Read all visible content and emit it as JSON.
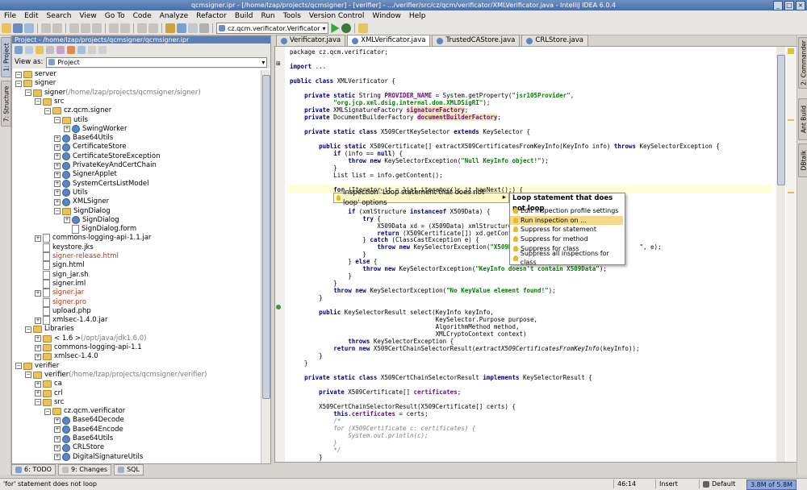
{
  "window": {
    "title": "qcmsigner.ipr - [/home/lzap/projects/qcmsigner] - [verifier] - .../verifier/src/cz/qcm/verificator/XMLVerificator.java - IntelliJ IDEA 6.0.4"
  },
  "menu": [
    "File",
    "Edit",
    "Search",
    "View",
    "Go To",
    "Code",
    "Analyze",
    "Refactor",
    "Build",
    "Run",
    "Tools",
    "Version Control",
    "Window",
    "Help"
  ],
  "toolbar": {
    "run_config": "cz.qcm.verificator.Verificator"
  },
  "left_stripe": {
    "project_tab": "1: Project",
    "structure_tab": "7: Structure"
  },
  "right_stripe": {
    "commander_tab": "2: Commander",
    "ant_tab": "Ant Build",
    "db_tab": "DBtalk"
  },
  "project": {
    "header": "Project - /home/lzap/projects/qcmsigner/qcmsigner.ipr",
    "view_as_label": "View as:",
    "view_as_value": "Project",
    "tree": [
      {
        "d": 0,
        "t": "-",
        "icon": "fold",
        "label": "server"
      },
      {
        "d": 0,
        "t": "-",
        "icon": "fold",
        "label": "signer"
      },
      {
        "d": 1,
        "t": "-",
        "icon": "fold",
        "label": "signer",
        "extra": " (/home/lzap/projects/qcmsigner/signer)"
      },
      {
        "d": 2,
        "t": "-",
        "icon": "fold",
        "label": "src"
      },
      {
        "d": 3,
        "t": "-",
        "icon": "fold",
        "label": "cz.qcm.signer"
      },
      {
        "d": 4,
        "t": "-",
        "icon": "fold",
        "label": "utils"
      },
      {
        "d": 5,
        "t": "+",
        "icon": "cls",
        "label": "SwingWorker"
      },
      {
        "d": 4,
        "t": "+",
        "icon": "cls",
        "label": "Base64Utils"
      },
      {
        "d": 4,
        "t": "+",
        "icon": "cls",
        "label": "CertificateStore"
      },
      {
        "d": 4,
        "t": "+",
        "icon": "cls",
        "label": "CertificateStoreException"
      },
      {
        "d": 4,
        "t": "+",
        "icon": "cls",
        "label": "PrivateKeyAndCertChain"
      },
      {
        "d": 4,
        "t": "+",
        "icon": "cls",
        "label": "SignerApplet"
      },
      {
        "d": 4,
        "t": "+",
        "icon": "cls",
        "label": "SystemCertsListModel"
      },
      {
        "d": 4,
        "t": "+",
        "icon": "cls",
        "label": "Utils"
      },
      {
        "d": 4,
        "t": "+",
        "icon": "cls",
        "label": "XMLSigner"
      },
      {
        "d": 4,
        "t": "-",
        "icon": "fold",
        "label": "SignDialog"
      },
      {
        "d": 5,
        "t": "+",
        "icon": "cls",
        "label": "SignDialog"
      },
      {
        "d": 5,
        "t": "",
        "icon": "file",
        "label": "SignDialog.form"
      },
      {
        "d": 2,
        "t": "+",
        "icon": "file",
        "label": "commons-logging-api-1.1.jar"
      },
      {
        "d": 2,
        "t": "",
        "icon": "file",
        "label": "keystore.jks"
      },
      {
        "d": 2,
        "t": "",
        "icon": "file",
        "label": "signer-release.html",
        "cls": "red"
      },
      {
        "d": 2,
        "t": "",
        "icon": "file",
        "label": "sign.html"
      },
      {
        "d": 2,
        "t": "",
        "icon": "file",
        "label": "sign_jar.sh"
      },
      {
        "d": 2,
        "t": "",
        "icon": "file",
        "label": "signer.iml"
      },
      {
        "d": 2,
        "t": "+",
        "icon": "file",
        "label": "signer.jar",
        "cls": "red"
      },
      {
        "d": 2,
        "t": "",
        "icon": "file",
        "label": "signer.pro",
        "cls": "red"
      },
      {
        "d": 2,
        "t": "",
        "icon": "file",
        "label": "upload.php"
      },
      {
        "d": 2,
        "t": "+",
        "icon": "file",
        "label": "xmlsec-1.4.0.jar"
      },
      {
        "d": 1,
        "t": "-",
        "icon": "fold",
        "label": "Libraries"
      },
      {
        "d": 2,
        "t": "+",
        "icon": "fold",
        "label": "< 1.6 >",
        "extra": " (/opt/java/jdk1.6.0)"
      },
      {
        "d": 2,
        "t": "+",
        "icon": "fold",
        "label": "commons-logging-api-1.1"
      },
      {
        "d": 2,
        "t": "+",
        "icon": "fold",
        "label": "xmlsec-1.4.0"
      },
      {
        "d": 0,
        "t": "-",
        "icon": "fold",
        "label": "verifier"
      },
      {
        "d": 1,
        "t": "-",
        "icon": "fold",
        "label": "verifier",
        "extra": " (/home/lzap/projects/qcmsigner/verifier)"
      },
      {
        "d": 2,
        "t": "+",
        "icon": "fold",
        "label": "ca"
      },
      {
        "d": 2,
        "t": "+",
        "icon": "fold",
        "label": "crl"
      },
      {
        "d": 2,
        "t": "-",
        "icon": "fold",
        "label": "src"
      },
      {
        "d": 3,
        "t": "-",
        "icon": "fold",
        "label": "cz.qcm.verificator"
      },
      {
        "d": 4,
        "t": "+",
        "icon": "cls",
        "label": "Base64Decode"
      },
      {
        "d": 4,
        "t": "+",
        "icon": "cls",
        "label": "Base64Encode"
      },
      {
        "d": 4,
        "t": "+",
        "icon": "cls",
        "label": "Base64Utils"
      },
      {
        "d": 4,
        "t": "+",
        "icon": "cls",
        "label": "CRLStore"
      },
      {
        "d": 4,
        "t": "+",
        "icon": "cls",
        "label": "DigitalSignatureUtils"
      }
    ]
  },
  "bottom_tabs": [
    "6: TODO",
    "9: Changes",
    "SQL"
  ],
  "editor": {
    "tabs": [
      "Verificator.java",
      "XMLVerificator.java",
      "TrustedCAStore.java",
      "CRLStore.java"
    ],
    "active_tab": 1,
    "lines": [
      [
        "package cz.qcm.verificator;"
      ],
      [
        ""
      ],
      [
        "[b]import[/b] ..."
      ],
      [
        ""
      ],
      [
        "[b]public class[/b] XMLVerificator {"
      ],
      [
        ""
      ],
      [
        "    [b]private static[/b] String [f]PROVIDER_NAME[/f] = System.getProperty([s]\"jsr105Provider\"[/s],"
      ],
      [
        "            [s]\"org.jcp.xml.dsig.internal.dom.XMLDSigRI\"[/s]);"
      ],
      [
        "    [b]private[/b] XMLSignatureFactory [h]signatureFactory[/h];"
      ],
      [
        "    [b]private[/b] DocumentBuilderFactory [h]documentBuilderFactory[/h];"
      ],
      [
        ""
      ],
      [
        "    [b]private static class[/b] X509CertKeySelector [b]extends[/b] KeySelector {"
      ],
      [
        ""
      ],
      [
        "        [b]public static[/b] X509Certificate[] extractX509CertificatesFromKeyInfo(KeyInfo info) [b]throws[/b] KeySelectorException {"
      ],
      [
        "            [b]if[/b] (info == [b]null[/b]) {"
      ],
      [
        "                [b]throw new[/b] KeySelectorException([s]\"Null KeyInfo object!\"[/s]);"
      ],
      [
        "            }"
      ],
      [
        "            List list = info.getContent();"
      ],
      [
        ""
      ],
      [
        "            [b]for[/b] (Iterator it = list.iterator(); it.hasNext();) {"
      ],
      [
        ""
      ],
      [
        ""
      ],
      [
        "                [b]if[/b] (xmlStructure [b]instanceof[/b] X509Data) {"
      ],
      [
        "                    [b]try[/b] {"
      ],
      [
        "                        X509Data xd = (X509Data) xmlStructure;"
      ],
      [
        "                        [b]return[/b] (X509Certificate[]) xd.getContent()"
      ],
      [
        "                    } [b]catch[/b] (ClassCastException e) {"
      ],
      [
        "                        [b]throw new[/b] KeySelectorException([s]\"X509Data m[/s]                              \", e);"
      ],
      [
        "                    }"
      ],
      [
        "                } [b]else[/b] {"
      ],
      [
        "                    [b]throw new[/b] KeySelectorException([s]\"KeyInfo doesn't contain X509Data\"[/s]);"
      ],
      [
        "                }"
      ],
      [
        "            }"
      ],
      [
        "            [b]throw new[/b] KeySelectorException([s]\"No KeyValue element found!\"[/s]);"
      ],
      [
        "        }"
      ],
      [
        ""
      ],
      [
        "        [b]public[/b] KeySelectorResult select(KeyInfo keyInfo,"
      ],
      [
        "                                        KeySelector.Purpose purpose,"
      ],
      [
        "                                        AlgorithmMethod method,"
      ],
      [
        "                                        XMLCryptoContext context)"
      ],
      [
        "                [b]throws[/b] KeySelectorException {"
      ],
      [
        "            [b]return new[/b] X509CertChainSelectorResult([i]extractX509CertificatesFromKeyInfo[/i](keyInfo));"
      ],
      [
        "        }"
      ],
      [
        "    }"
      ],
      [
        ""
      ],
      [
        "    [b]private static class[/b] X509CertChainSelectorResult [b]implements[/b] KeySelectorResult {"
      ],
      [
        ""
      ],
      [
        "        [b]private[/b] X509Certificate[] [f]certificates[/f];"
      ],
      [
        ""
      ],
      [
        "        X509CertChainSelectorResult(X509Certificate[] certs) {"
      ],
      [
        "            [b]this[/b].[f]certificates[/f] = certs;"
      ],
      [
        "            [c]/*[/c]"
      ],
      [
        "            [c]for (X509Certificate c: certificates) {[/c]"
      ],
      [
        "            [c]    System.out.println(c);[/c]"
      ],
      [
        "            [c]}[/c]"
      ],
      [
        "            [c]*/[/c]"
      ],
      [
        "        }"
      ]
    ]
  },
  "inspection_popup": {
    "label": "Inspection 'Loop statement that does not loop' options",
    "submenu_title": "Loop statement that does not loop",
    "items": [
      "Edit inspection profile settings",
      "Run inspection on ...",
      "Suppress for statement",
      "Suppress for method",
      "Suppress for class",
      "Suppress all inspections for class"
    ],
    "selected": 1
  },
  "status": {
    "message": "'for' statement does not loop",
    "position": "46:14",
    "mode": "Insert",
    "profile": "Default",
    "memory": "3.8M of 5.8M"
  }
}
